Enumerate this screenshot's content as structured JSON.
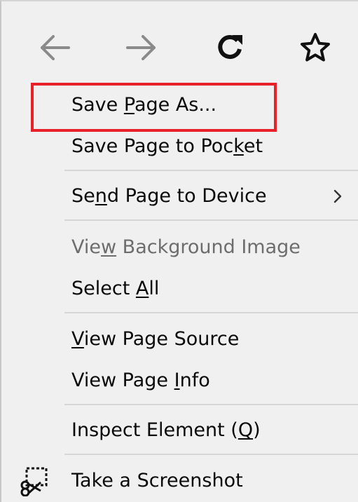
{
  "toolbar": {
    "back_icon": "back-arrow-icon",
    "forward_icon": "forward-arrow-icon",
    "reload_icon": "reload-icon",
    "bookmark_icon": "star-icon"
  },
  "menu": {
    "save_page_as": {
      "pre": "Save ",
      "key": "P",
      "post": "age As..."
    },
    "save_to_pocket": {
      "pre": "Save Page to Poc",
      "key": "k",
      "post": "et"
    },
    "send_to_device": {
      "pre": "Se",
      "key": "n",
      "post": "d Page to Device"
    },
    "view_background_image": {
      "pre": "Vie",
      "key": "w",
      "post": " Background Image"
    },
    "select_all": {
      "pre": "Select ",
      "key": "A",
      "post": "ll"
    },
    "view_page_source": {
      "pre": "",
      "key": "V",
      "post": "iew Page Source"
    },
    "view_page_info": {
      "pre": "View Page ",
      "key": "I",
      "post": "nfo"
    },
    "inspect_element": {
      "pre": "Inspect Element (",
      "key": "Q",
      "post": ")"
    },
    "take_screenshot": {
      "label": "Take a Screenshot"
    }
  },
  "colors": {
    "menu_bg": "#f0f0f0",
    "highlight": "#e8202a",
    "disabled_text": "#6d6d6d",
    "nav_arrow_gray": "#8a8a8a"
  }
}
